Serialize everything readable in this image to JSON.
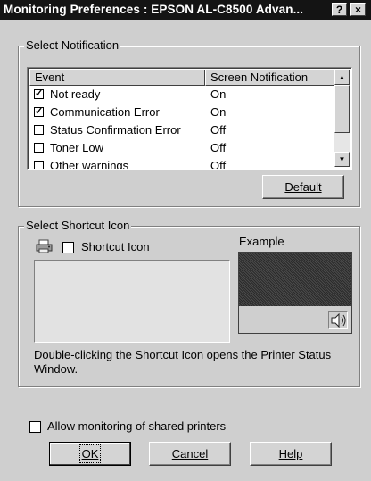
{
  "window": {
    "title": "Monitoring Preferences : EPSON AL-C8500 Advan...",
    "help_button": "?",
    "close_button": "×"
  },
  "notification": {
    "group_label": "Select Notification",
    "columns": [
      "Event",
      "Screen Notification"
    ],
    "rows": [
      {
        "event": "Not ready",
        "notify": "On",
        "checked": true
      },
      {
        "event": "Communication Error",
        "notify": "On",
        "checked": true
      },
      {
        "event": "Status Confirmation Error",
        "notify": "Off",
        "checked": false
      },
      {
        "event": "Toner Low",
        "notify": "Off",
        "checked": false
      },
      {
        "event": "Other warnings",
        "notify": "Off",
        "checked": false
      }
    ],
    "default_button": "Default"
  },
  "shortcut": {
    "group_label": "Select Shortcut Icon",
    "checkbox_label": "Shortcut Icon",
    "checked": false,
    "example_label": "Example",
    "description": "Double-clicking the Shortcut Icon opens the Printer Status Window."
  },
  "shared": {
    "checkbox_label": "Allow monitoring of shared printers",
    "checked": false
  },
  "buttons": {
    "ok": "OK",
    "cancel": "Cancel",
    "help": "Help"
  }
}
